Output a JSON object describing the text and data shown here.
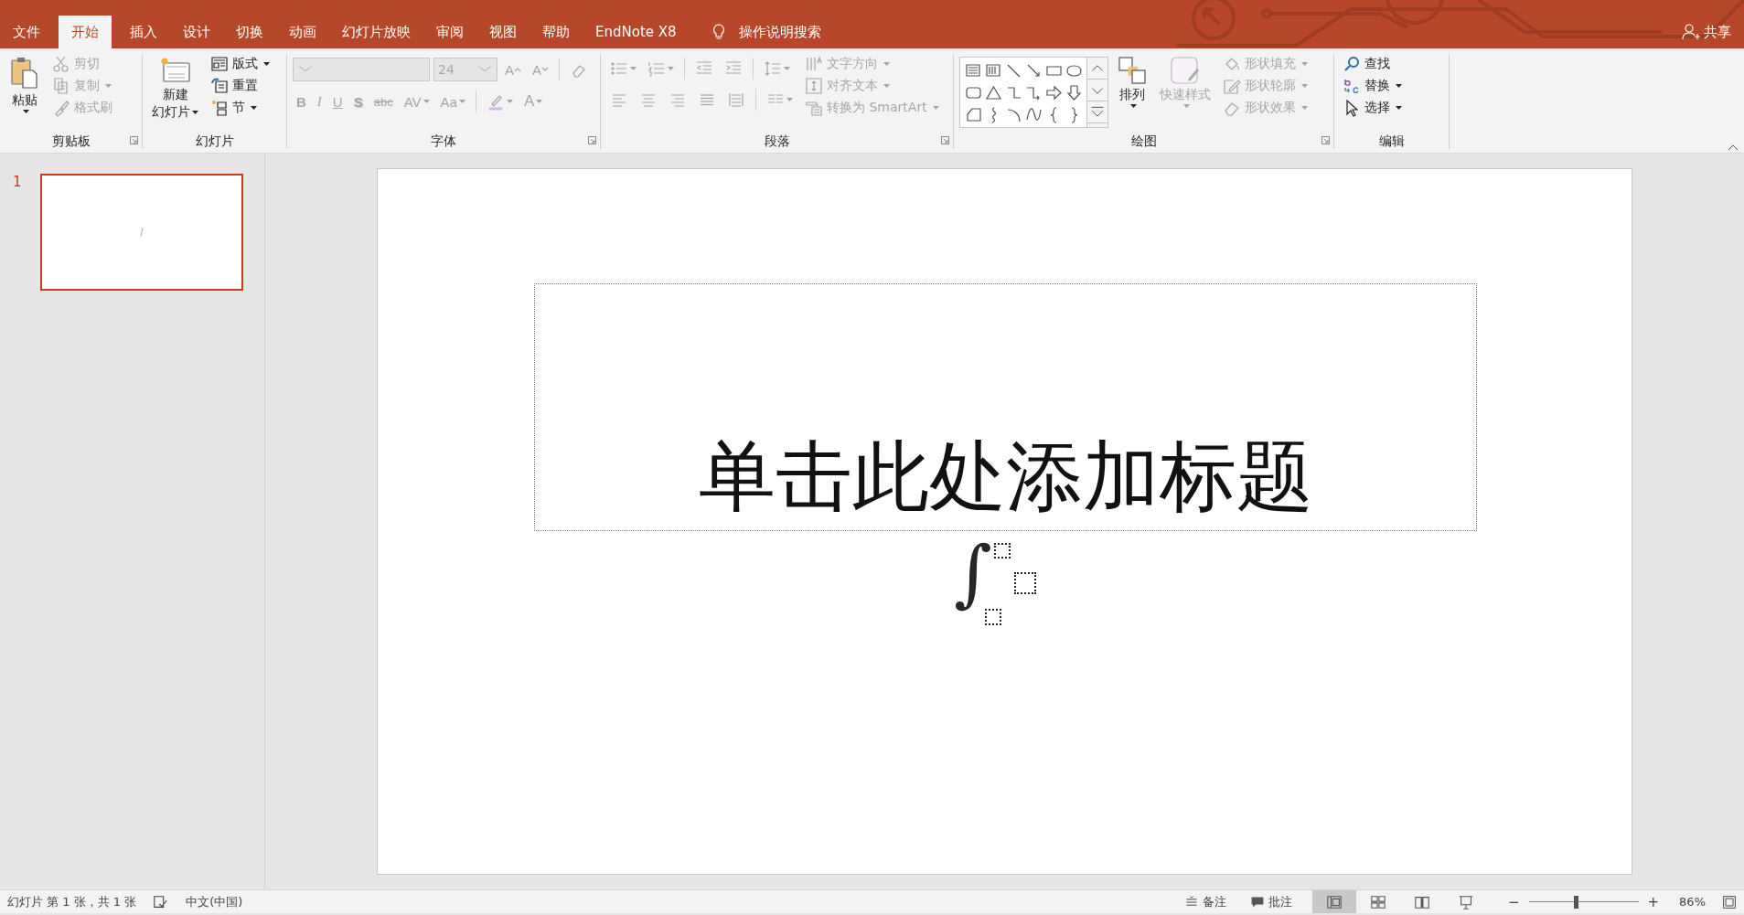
{
  "tabs": [
    {
      "label": "文件",
      "selected": false
    },
    {
      "label": "开始",
      "selected": true
    },
    {
      "label": "插入",
      "selected": false
    },
    {
      "label": "设计",
      "selected": false
    },
    {
      "label": "切换",
      "selected": false
    },
    {
      "label": "动画",
      "selected": false
    },
    {
      "label": "幻灯片放映",
      "selected": false
    },
    {
      "label": "审阅",
      "selected": false
    },
    {
      "label": "视图",
      "selected": false
    },
    {
      "label": "帮助",
      "selected": false
    },
    {
      "label": "EndNote X8",
      "selected": false
    }
  ],
  "tell_me": {
    "placeholder": "操作说明搜索"
  },
  "share": "共享",
  "ribbon": {
    "groups": [
      {
        "label": "剪贴板",
        "items": [
          {
            "label": "粘贴",
            "disabled": false,
            "dropdown": true
          },
          {
            "label": "剪切",
            "disabled": true,
            "dropdown": false
          },
          {
            "label": "复制",
            "disabled": true,
            "dropdown": true
          },
          {
            "label": "格式刷",
            "disabled": true,
            "dropdown": false
          }
        ]
      },
      {
        "label": "幻灯片",
        "items": [
          {
            "label_lines": [
              "新建",
              "幻灯片"
            ],
            "disabled": false,
            "dropdown": true
          },
          {
            "label": "版式",
            "disabled": false,
            "dropdown": true
          },
          {
            "label": "重置",
            "disabled": false,
            "dropdown": false
          },
          {
            "label": "节",
            "disabled": false,
            "dropdown": true
          }
        ]
      },
      {
        "label": "字体",
        "items": [
          {
            "disabled": true
          },
          {
            "value": "24",
            "disabled": true
          },
          {
            "label": "A",
            "disabled": true
          },
          {
            "label": "A",
            "disabled": true
          },
          {
            "disabled": true
          },
          {
            "label": "B",
            "disabled": true
          },
          {
            "label": "I",
            "disabled": true
          },
          {
            "label": "U",
            "disabled": true
          },
          {
            "label": "S",
            "disabled": true
          },
          {
            "label": "abc",
            "disabled": true
          },
          {
            "label": "AV",
            "disabled": true,
            "dropdown": true
          },
          {
            "label": "Aa",
            "disabled": true,
            "dropdown": true
          },
          {
            "disabled": true,
            "dropdown": true
          },
          {
            "label": "A",
            "disabled": true,
            "dropdown": true
          }
        ]
      },
      {
        "label": "段落",
        "items": [
          {
            "disabled": true,
            "dropdown": true
          },
          {
            "disabled": true,
            "dropdown": true
          },
          {
            "disabled": true
          },
          {
            "disabled": true
          },
          {
            "disabled": true,
            "dropdown": true
          },
          {
            "disabled": true
          },
          {
            "disabled": true
          },
          {
            "disabled": true
          },
          {
            "disabled": true
          },
          {
            "disabled": true
          },
          {
            "disabled": true,
            "dropdown": true
          },
          {
            "label": "文字方向",
            "disabled": true,
            "dropdown": true
          },
          {
            "label": "对齐文本",
            "disabled": true,
            "dropdown": true
          },
          {
            "label": "转换为 SmartArt",
            "disabled": true,
            "dropdown": true
          }
        ]
      },
      {
        "label": "绘图",
        "items": [
          {
            "disabled": false
          },
          {
            "label": "排列",
            "disabled": false,
            "dropdown": true
          },
          {
            "label": "快速样式",
            "disabled": true,
            "dropdown": true
          },
          {
            "label": "形状填充",
            "disabled": true,
            "dropdown": true
          },
          {
            "label": "形状轮廓",
            "disabled": true,
            "dropdown": true
          },
          {
            "label": "形状效果",
            "disabled": true,
            "dropdown": true
          }
        ]
      },
      {
        "label": "编辑",
        "items": [
          {
            "label": "查找",
            "disabled": false,
            "dropdown": false
          },
          {
            "label": "替换",
            "disabled": false,
            "dropdown": true
          },
          {
            "label": "选择",
            "disabled": false,
            "dropdown": true
          }
        ]
      }
    ]
  },
  "slides_pane": {
    "slides": [
      {
        "number": "1",
        "selected": true
      }
    ]
  },
  "slide": {
    "title_placeholder": "单击此处添加标题",
    "equation": {
      "symbol": "∫"
    }
  },
  "status_bar": {
    "slide_info": "幻灯片 第 1 张，共 1 张",
    "language": "中文(中国)",
    "notes": "备注",
    "comments": "批注",
    "views": [
      {
        "selected": true
      },
      {
        "selected": false
      },
      {
        "selected": false
      },
      {
        "selected": false
      }
    ],
    "zoom": {
      "minus": "−",
      "plus": "+",
      "level": 0.43,
      "percent": "86%"
    }
  }
}
